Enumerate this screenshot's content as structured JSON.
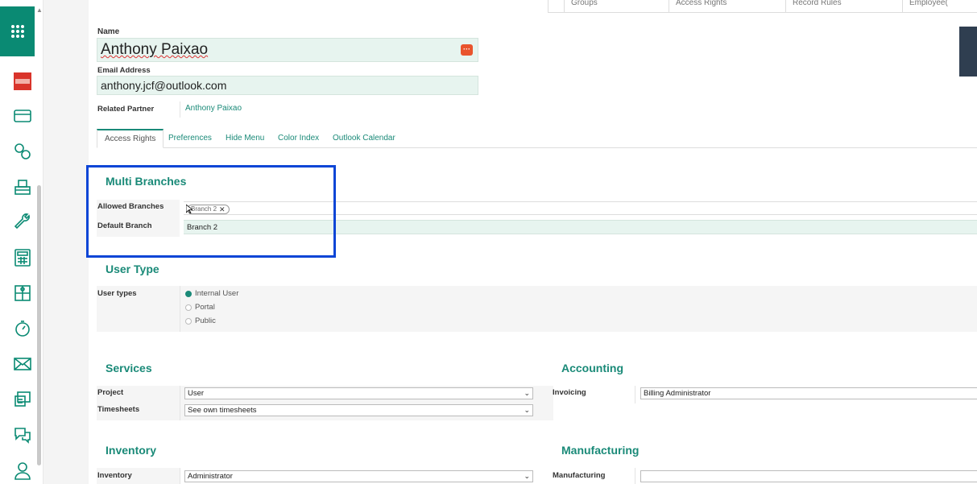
{
  "top_stats": [
    "Groups",
    "Access Rights",
    "Record Rules",
    "Employee("
  ],
  "form": {
    "name_label": "Name",
    "name_value": "Anthony Paixao",
    "email_label": "Email Address",
    "email_value": "anthony.jcf@outlook.com",
    "related_partner_label": "Related Partner",
    "related_partner_value": "Anthony Paixao"
  },
  "tabs": [
    "Access Rights",
    "Preferences",
    "Hide Menu",
    "Color Index",
    "Outlook Calendar"
  ],
  "multi_branches": {
    "title": "Multi Branches",
    "allowed_label": "Allowed Branches",
    "allowed_tag": "Branch 2",
    "default_label": "Default Branch",
    "default_value": "Branch 2"
  },
  "user_type": {
    "title": "User Type",
    "label": "User types",
    "options": [
      "Internal User",
      "Portal",
      "Public"
    ],
    "selected": "Internal User"
  },
  "services": {
    "title": "Services",
    "project_label": "Project",
    "project_value": "User",
    "timesheets_label": "Timesheets",
    "timesheets_value": "See own timesheets"
  },
  "accounting": {
    "title": "Accounting",
    "invoicing_label": "Invoicing",
    "invoicing_value": "Billing Administrator"
  },
  "inventory": {
    "title": "Inventory",
    "inventory_label": "Inventory",
    "inventory_value": "Administrator"
  },
  "manufacturing": {
    "title": "Manufacturing",
    "manufacturing_label": "Manufacturing",
    "manufacturing_value": ""
  },
  "colors": {
    "brand": "#0a8a73",
    "highlight": "#0c45d6",
    "field_bg": "#e7f4ef"
  }
}
